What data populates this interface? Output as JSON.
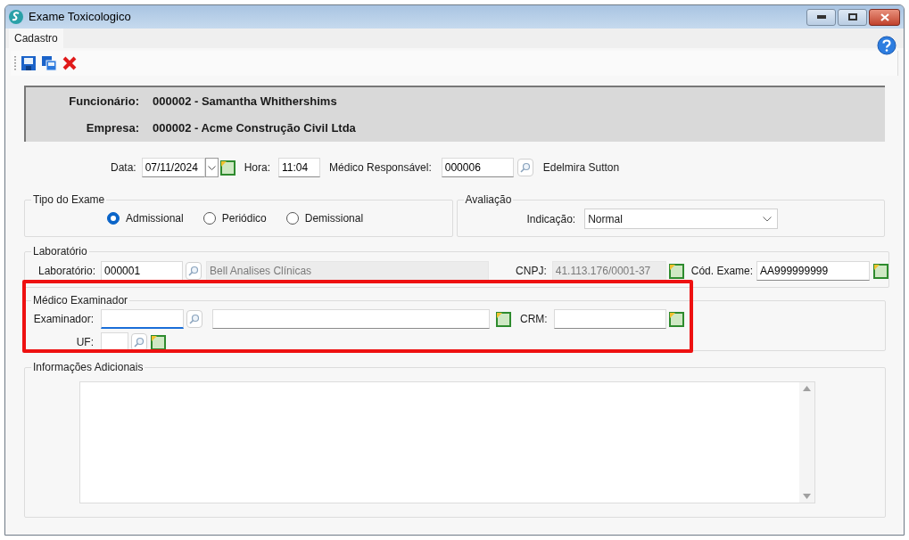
{
  "window": {
    "title": "Exame Toxicologico"
  },
  "tabs": [
    {
      "label": "Cadastro",
      "selected": true
    }
  ],
  "header": [
    {
      "label": "Funcionário:",
      "value": "000002 - Samantha Whithershims"
    },
    {
      "label": "Empresa:",
      "value": "000002 - Acme Construção Civil Ltda"
    }
  ],
  "schedule": {
    "date_label": "Data:",
    "date": "07/11/2024",
    "time_label": "Hora:",
    "time": "11:04",
    "doctor_label": "Médico Responsável:",
    "doctor_code": "000006",
    "doctor_name": "Edelmira Sutton"
  },
  "exam_type": {
    "title": "Tipo do Exame",
    "options": [
      {
        "label": "Admissional",
        "selected": true
      },
      {
        "label": "Periódico",
        "selected": false
      },
      {
        "label": "Demissional",
        "selected": false
      }
    ]
  },
  "evaluation": {
    "title": "Avaliação",
    "label": "Indicação:",
    "value": "Normal"
  },
  "laboratory": {
    "title": "Laboratório",
    "label": "Laboratório:",
    "code": "000001",
    "name": "Bell Analises Clínicas",
    "cnpj_label": "CNPJ:",
    "cnpj": "41.113.176/0001-37",
    "exam_code_label": "Cód. Exame:",
    "exam_code": "AA999999999"
  },
  "examiner": {
    "title": "Médico Examinador",
    "label": "Examinador:",
    "focused": true,
    "crm_label": "CRM:",
    "uf_label": "UF:"
  },
  "additional_info": {
    "title": "Informações Adicionais"
  }
}
